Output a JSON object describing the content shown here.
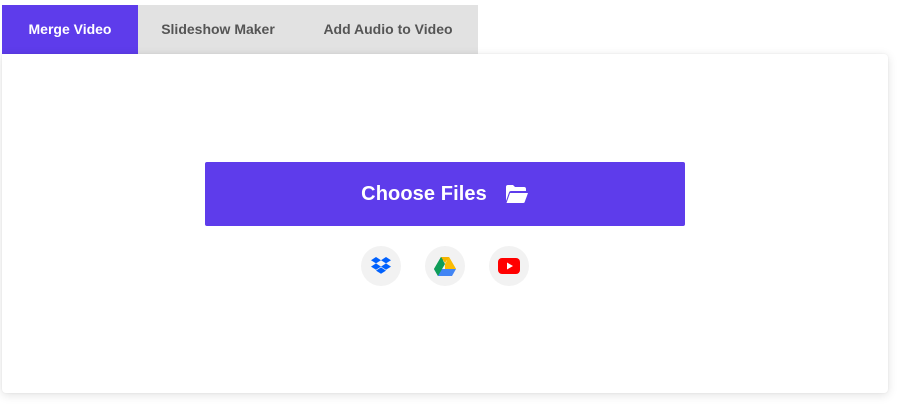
{
  "tabs": [
    {
      "label": "Merge Video",
      "active": true
    },
    {
      "label": "Slideshow Maker",
      "active": false
    },
    {
      "label": "Add Audio to Video",
      "active": false
    }
  ],
  "upload": {
    "button_label": "Choose Files",
    "button_icon": "folder-open-icon"
  },
  "sources": [
    {
      "icon": "dropbox-icon"
    },
    {
      "icon": "google-drive-icon"
    },
    {
      "icon": "youtube-icon"
    }
  ],
  "colors": {
    "accent": "#5e3ceb",
    "tab_inactive_bg": "#e2e2e2",
    "tab_inactive_text": "#555555",
    "dropbox": "#0061fe",
    "youtube": "#ff0000"
  }
}
